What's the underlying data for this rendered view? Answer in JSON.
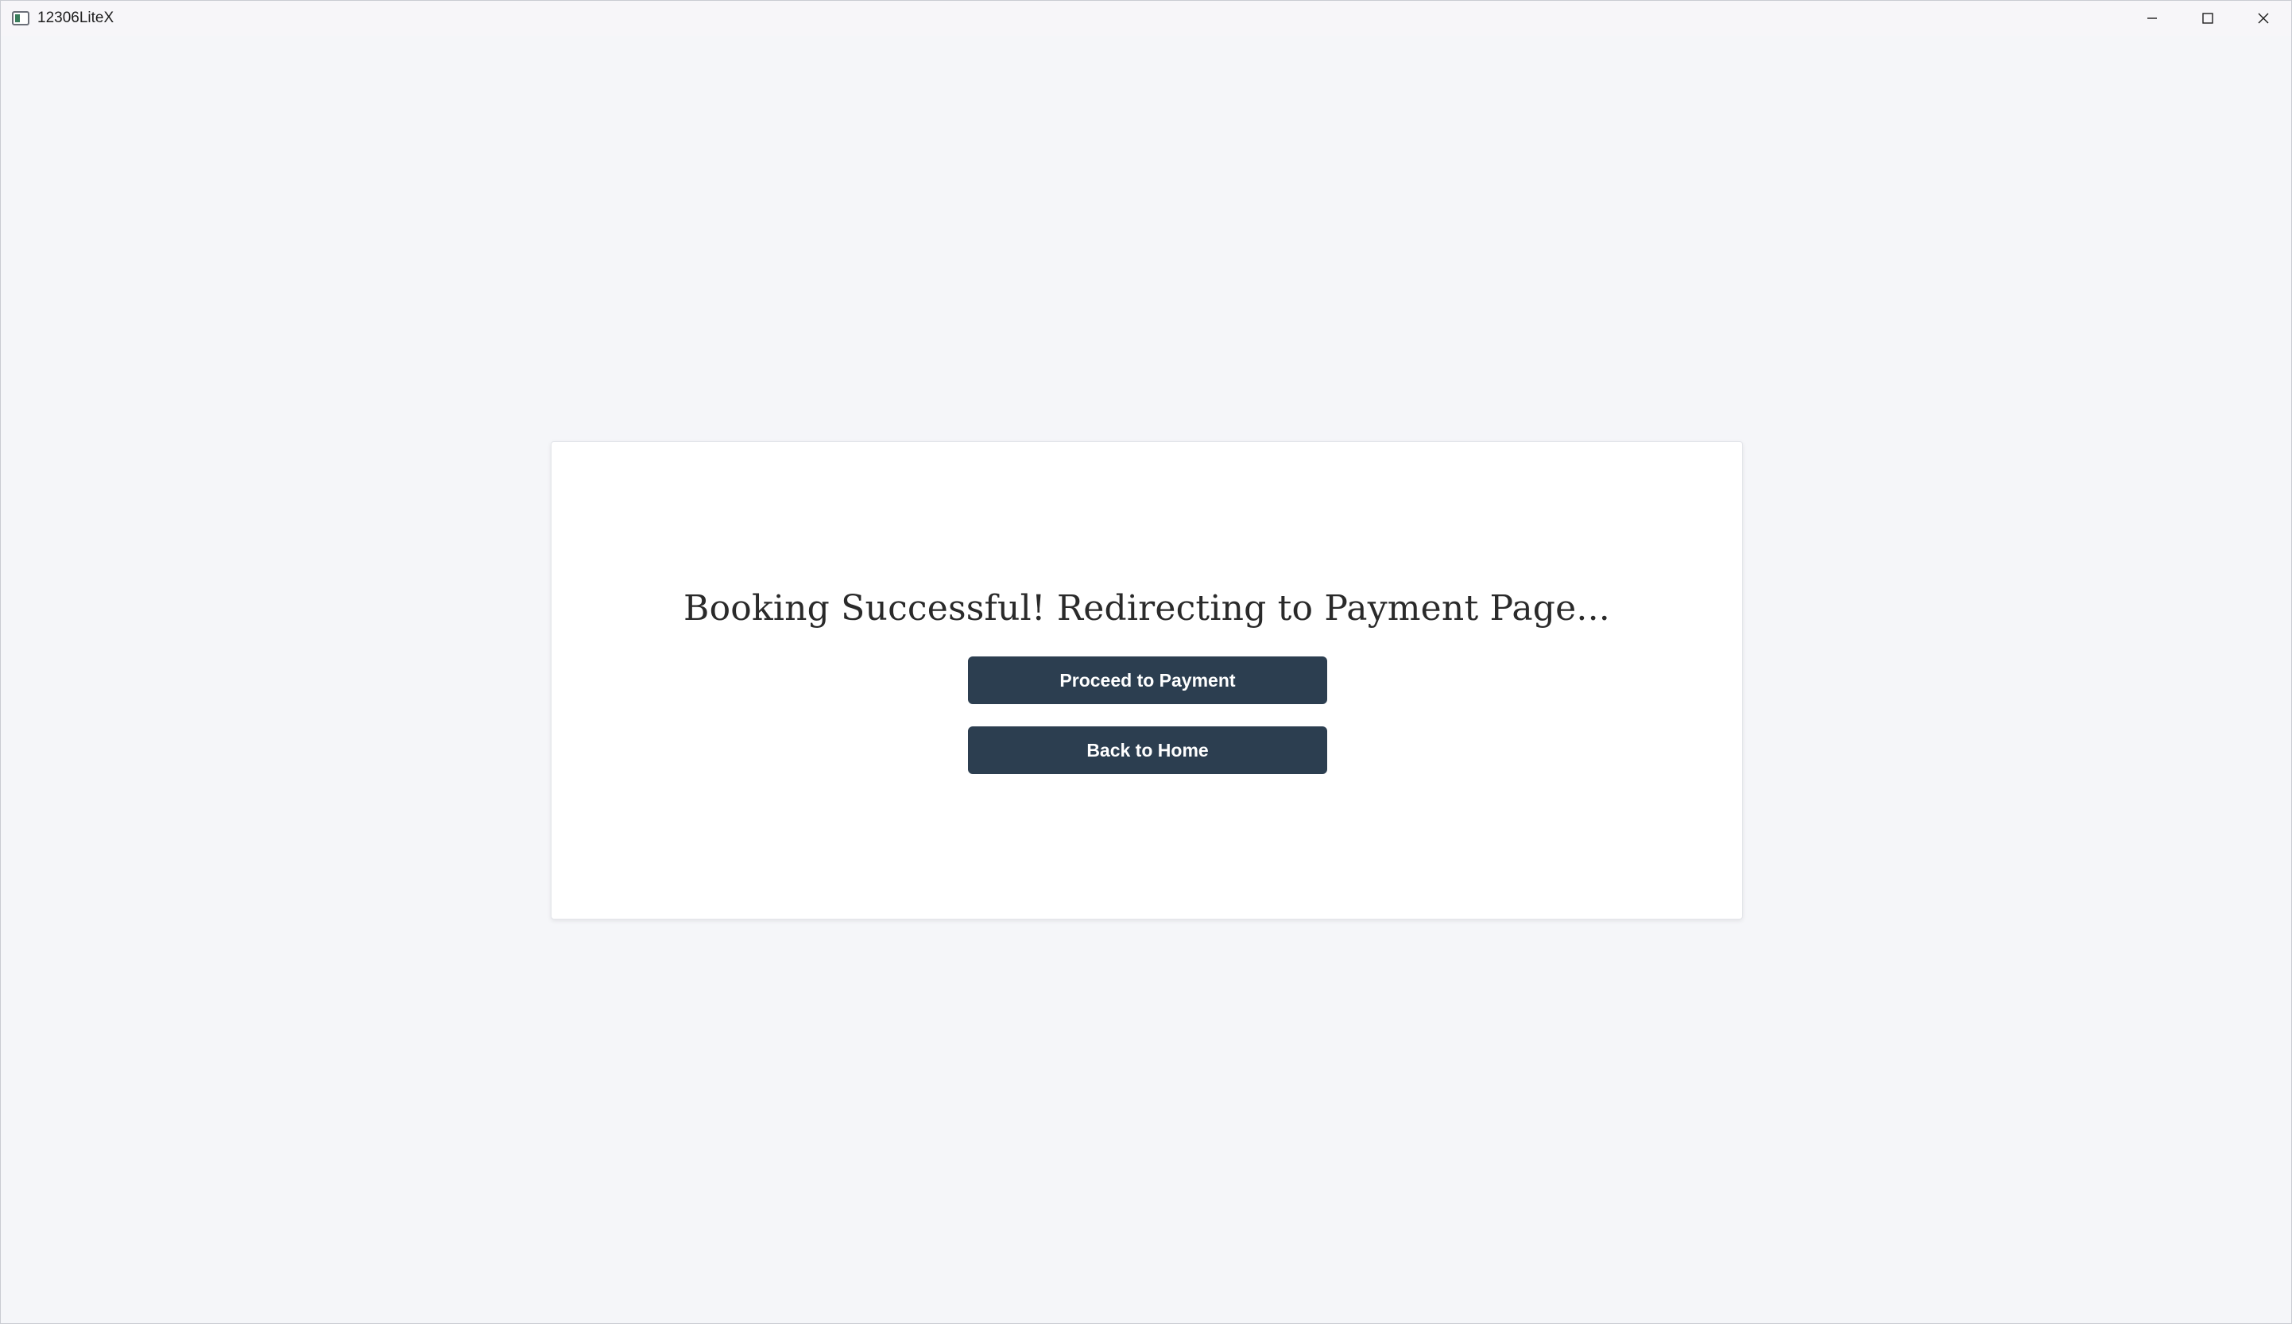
{
  "window": {
    "title": "12306LiteX",
    "controls": {
      "minimize_icon": "minimize-icon",
      "maximize_icon": "maximize-icon",
      "close_icon": "close-icon"
    }
  },
  "card": {
    "message": "Booking Successful! Redirecting to Payment Page...",
    "buttons": {
      "proceed_label": "Proceed to Payment",
      "home_label": "Back to Home"
    }
  },
  "colors": {
    "background": "#f5f6f9",
    "card": "#ffffff",
    "button": "#2c3e50",
    "button_text": "#ffffff"
  }
}
